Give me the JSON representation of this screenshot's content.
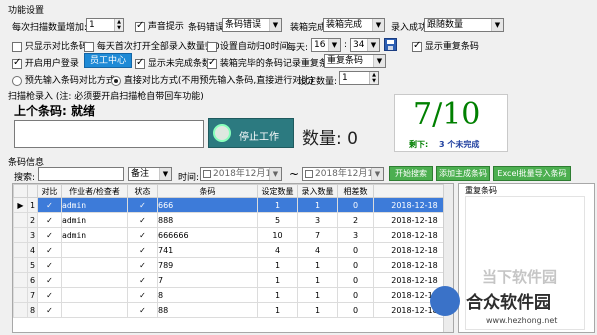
{
  "settings": {
    "title": "功能设置",
    "row1": {
      "scan_inc_label": "每次扫描数量增加:",
      "scan_inc_value": "1",
      "sound_label": "声音提示",
      "barcode_error_label": "条码错误",
      "barcode_error_value": "条码错误",
      "box_full_label": "装箱完成",
      "box_full_value": "装箱完成",
      "entry_success_label": "录入成功",
      "entry_success_value": "跟随数量"
    },
    "row2": {
      "show_compare_label": "只显示对比条码",
      "daily_import_label": "每天首次打开全部录入数量归0",
      "auto_reset_label": "设置自动归0时间",
      "daily_label": "每天:",
      "hour_value": "16",
      "minute_sep": ":",
      "minute_value": "34",
      "show_dup_label": "显示重复条码"
    },
    "row3": {
      "user_login_label": "开启用户登录",
      "staff_center_label": "员工中心",
      "show_unfinished_label": "显示未完成条数",
      "box_done_record_label": "装箱完毕的条码记录重复条码",
      "dup_value": "重复条码"
    },
    "row4": {
      "preset_label": "预先输入条码对比方式",
      "direct_label": "直接对比方式(不用预先输入条码,直接进行对比)",
      "set_qty_label": "设定数量:",
      "set_qty_value": "1"
    }
  },
  "scan": {
    "title": "扫描枪录入 (注: 必须要开启扫描枪自带回车功能)",
    "last_barcode_label": "上个条码: 就绪",
    "stop_button": "停止工作",
    "qty_label": "数量: 0",
    "progress_big": "7/10",
    "remaining_label": "剩下:",
    "remaining_text": "3 个未完成"
  },
  "barcode_info": {
    "title": "条码信息",
    "search_label": "搜索:",
    "search_value": "",
    "field_select": "备注",
    "time_label": "时间:",
    "date_from": "2018年12月19日",
    "tilde": "~",
    "date_to": "2018年12月19日",
    "btn_search": "开始搜索",
    "btn_add": "添加主成条码",
    "btn_excel": "Excel批量导入条码",
    "columns": [
      "对比",
      "作业者/检查者",
      "状态",
      "条码",
      "设定数量",
      "录入数量",
      "相差数",
      "时"
    ],
    "rows": [
      {
        "no": "1",
        "cmp": "✓",
        "op": "admin",
        "status": "✓",
        "code": "666",
        "set": "1",
        "in": "1",
        "diff": "0",
        "time": "2018-12-18"
      },
      {
        "no": "2",
        "cmp": "✓",
        "op": "admin",
        "status": "✓",
        "code": "888",
        "set": "5",
        "in": "3",
        "diff": "2",
        "time": "2018-12-18"
      },
      {
        "no": "3",
        "cmp": "✓",
        "op": "admin",
        "status": "✓",
        "code": "666666",
        "set": "10",
        "in": "7",
        "diff": "3",
        "time": "2018-12-18"
      },
      {
        "no": "4",
        "cmp": "✓",
        "op": "",
        "status": "✓",
        "code": "741",
        "set": "4",
        "in": "4",
        "diff": "0",
        "time": "2018-12-18"
      },
      {
        "no": "5",
        "cmp": "✓",
        "op": "",
        "status": "✓",
        "code": "789",
        "set": "1",
        "in": "1",
        "diff": "0",
        "time": "2018-12-18"
      },
      {
        "no": "6",
        "cmp": "✓",
        "op": "",
        "status": "✓",
        "code": "7",
        "set": "1",
        "in": "1",
        "diff": "0",
        "time": "2018-12-18"
      },
      {
        "no": "7",
        "cmp": "✓",
        "op": "",
        "status": "✓",
        "code": "8",
        "set": "1",
        "in": "1",
        "diff": "0",
        "time": "2018-12-18"
      },
      {
        "no": "8",
        "cmp": "✓",
        "op": "",
        "status": "✓",
        "code": "88",
        "set": "1",
        "in": "1",
        "diff": "0",
        "time": "2018-12-18"
      }
    ]
  },
  "dup_panel": {
    "title": "重复条码"
  },
  "watermark": {
    "line1": "当下软件园",
    "line2": "合众软件园",
    "url": "www.hezhong.net"
  },
  "colors": {
    "green": "#008000",
    "blue_dark": "#1f3f9f",
    "accent_btn": "#4caf50",
    "selected_row": "#3d7bd9"
  }
}
